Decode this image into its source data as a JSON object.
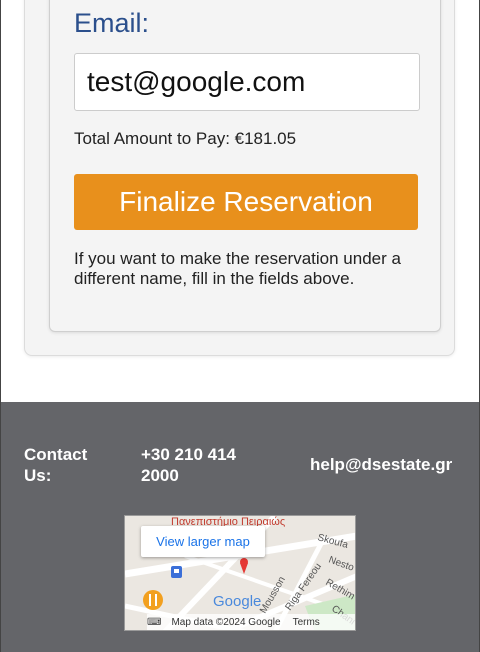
{
  "form": {
    "email_label": "Email:",
    "email_value": "test@google.com",
    "total_text": "Total Amount to Pay: €181.05",
    "finalize_label": "Finalize Reservation",
    "note_text": "If you want to make the reservation under a different name, fill in the fields above."
  },
  "footer": {
    "contact_label": "Contact Us:",
    "phone": "+30 210 414 2000",
    "email": "help@dsestate.gr",
    "map": {
      "larger_map_label": "View larger map",
      "attribution": "Map data ©2024 Google",
      "terms_label": "Terms",
      "place_label": "Πανεπιστήμιο Πειραιώς",
      "street_labels": [
        "Skoufa",
        "Nesto",
        "Rethim",
        "Riga Fereou",
        "Mousson",
        "Chani"
      ],
      "logo_text": "Google"
    }
  },
  "colors": {
    "accent_button": "#e8901c",
    "email_label": "#2b4f8c",
    "footer_bg": "#646569",
    "map_link": "#1a73e8"
  }
}
